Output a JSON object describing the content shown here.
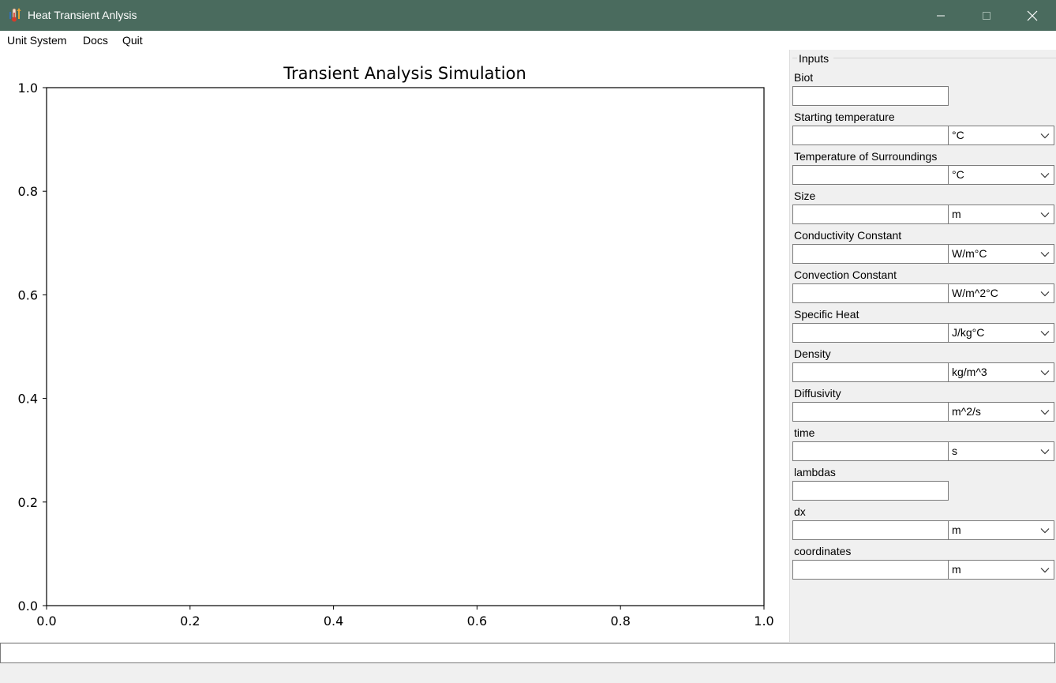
{
  "window": {
    "title": "Heat Transient Anlysis",
    "titlebar_color": "#4a6b5e",
    "controls": {
      "minimize": "minimize-icon",
      "maximize": "maximize-icon",
      "close": "close-icon"
    }
  },
  "menu": {
    "items": [
      "Unit System",
      "Docs",
      "Quit"
    ]
  },
  "chart_data": {
    "type": "line",
    "title": "Transient Analysis Simulation",
    "xlabel": "",
    "ylabel": "",
    "xlim": [
      0.0,
      1.0
    ],
    "ylim": [
      0.0,
      1.0
    ],
    "xticks": [
      "0.0",
      "0.2",
      "0.4",
      "0.6",
      "0.8",
      "1.0"
    ],
    "yticks": [
      "0.0",
      "0.2",
      "0.4",
      "0.6",
      "0.8",
      "1.0"
    ],
    "series": [],
    "grid": false
  },
  "inputs": {
    "group_title": "Inputs",
    "fields": [
      {
        "label": "Biot",
        "value": "",
        "unit": null
      },
      {
        "label": "Starting temperature",
        "value": "",
        "unit": "°C"
      },
      {
        "label": "Temperature of Surroundings",
        "value": "",
        "unit": "°C"
      },
      {
        "label": "Size",
        "value": "",
        "unit": "m"
      },
      {
        "label": "Conductivity Constant",
        "value": "",
        "unit": "W/m°C"
      },
      {
        "label": "Convection Constant",
        "value": "",
        "unit": "W/m^2°C"
      },
      {
        "label": "Specific Heat",
        "value": "",
        "unit": "J/kg°C"
      },
      {
        "label": "Density",
        "value": "",
        "unit": "kg/m^3"
      },
      {
        "label": "Diffusivity",
        "value": "",
        "unit": "m^2/s"
      },
      {
        "label": "time",
        "value": "",
        "unit": "s"
      },
      {
        "label": "lambdas",
        "value": "",
        "unit": null
      },
      {
        "label": "dx",
        "value": "",
        "unit": "m"
      },
      {
        "label": "coordinates",
        "value": "",
        "unit": "m"
      }
    ]
  },
  "status": {
    "value": ""
  }
}
